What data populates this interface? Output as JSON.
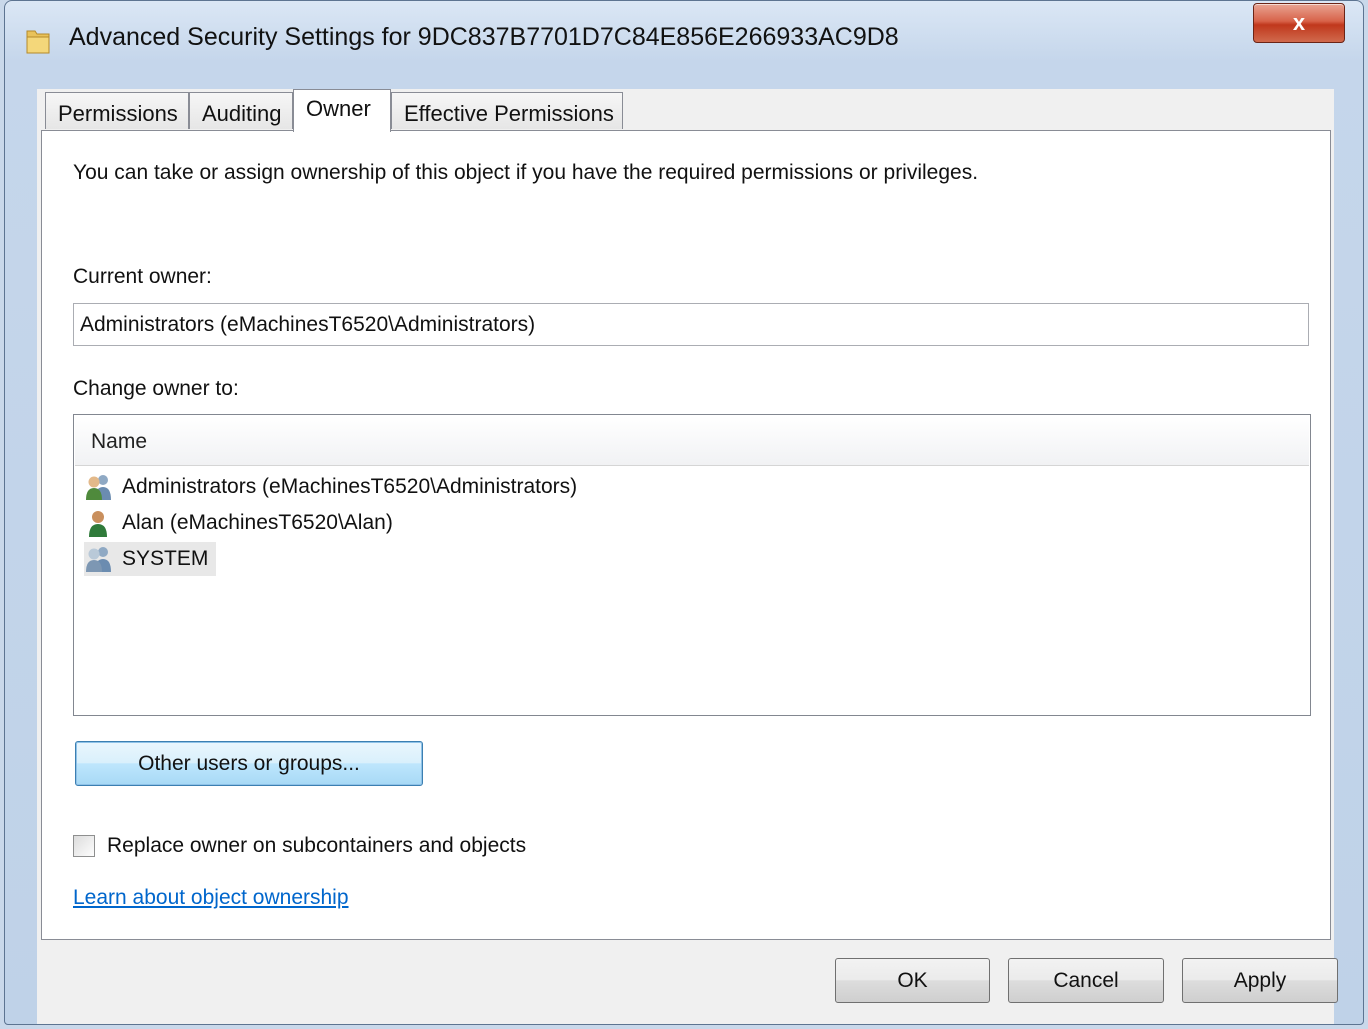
{
  "window": {
    "title": "Advanced Security Settings for 9DC837B7701D7C84E856E266933AC9D8",
    "close_label": "x"
  },
  "tabs": [
    {
      "label": "Permissions",
      "active": false
    },
    {
      "label": "Auditing",
      "active": false
    },
    {
      "label": "Owner",
      "active": true
    },
    {
      "label": "Effective Permissions",
      "active": false
    }
  ],
  "owner": {
    "intro": "You can take or assign ownership of this object if you have the required permissions or privileges.",
    "current_owner_label": "Current owner:",
    "current_owner_value": "Administrators (eMachinesT6520\\Administrators)",
    "change_owner_label": "Change owner to:",
    "list_header": "Name",
    "list_items": [
      {
        "label": "Administrators (eMachinesT6520\\Administrators)",
        "icon": "group-icon",
        "selected": false
      },
      {
        "label": "Alan (eMachinesT6520\\Alan)",
        "icon": "user-icon",
        "selected": false
      },
      {
        "label": "SYSTEM",
        "icon": "group-icon",
        "selected": true
      }
    ],
    "other_users_button": "Other users or groups...",
    "replace_checkbox_label": "Replace owner on subcontainers and objects",
    "replace_checked": false,
    "learn_link": "Learn about object ownership"
  },
  "footer": {
    "ok": "OK",
    "cancel": "Cancel",
    "apply": "Apply"
  },
  "colors": {
    "accent": "#3c7fb1",
    "link": "#0066cc",
    "close": "#c0371c"
  }
}
